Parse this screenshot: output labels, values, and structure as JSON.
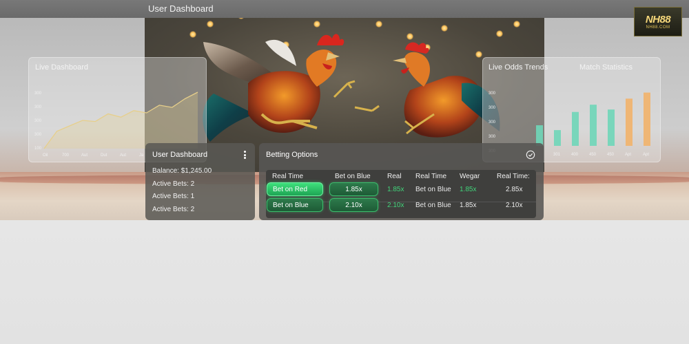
{
  "app": {
    "title": "User Dashboard",
    "logo_line1": "NH88",
    "logo_line2": "NH88.COM"
  },
  "left_panel": {
    "title": "Live Dashboard",
    "y_ticks": [
      "300",
      "300",
      "300",
      "300",
      "100"
    ],
    "x_ticks": [
      "Oil",
      "700",
      "Aut",
      "Dut",
      "Aut",
      "Ja"
    ]
  },
  "right_panel": {
    "title_1": "Live Odds Trends",
    "title_2": "Match Statistics",
    "y_ticks": [
      "300",
      "300",
      "300",
      "300",
      "300"
    ],
    "x_ticks": [
      "301",
      "400",
      "450",
      "450",
      "Apt",
      "Apt"
    ]
  },
  "user_card": {
    "title": "User Dashboard",
    "balance": "Balance: $1,245.00",
    "active_1": "Active Bets: 2",
    "active_2": "Active Bets: 1",
    "active_3": "Active Bets: 2"
  },
  "betting": {
    "title": "Betting Options",
    "headers": [
      "Real Time",
      "Bet on Blue",
      "Real",
      "Real Time",
      "Wegar",
      "Real Time:"
    ],
    "rows": [
      {
        "bet": "Bet on Red",
        "odds": "1.85x",
        "real": "1.85x",
        "label": "Bet on Blue",
        "wager": "1.85x",
        "rt": "2.85x"
      },
      {
        "bet": "Bet on Blue",
        "odds": "2.10x",
        "real": "2.10x",
        "label": "Bet on Blue",
        "wager": "1.85x",
        "rt": "2.10x"
      }
    ]
  },
  "colors": {
    "accent_green": "#41d47a",
    "bar_teal": "#6fd6b8",
    "bar_orange": "#f2b36a",
    "line_gold": "#e7cf8a"
  },
  "chart_data": [
    {
      "type": "area",
      "title": "Live Dashboard",
      "x": [
        "Oil",
        "700",
        "Aut",
        "Dut",
        "Aut",
        "Ja"
      ],
      "series": [
        {
          "values": [
            100,
            180,
            205,
            230,
            225,
            260,
            245,
            275,
            265,
            300,
            290,
            330,
            360
          ]
        }
      ],
      "ylim": [
        100,
        360
      ]
    },
    {
      "type": "bar",
      "title": "Match Statistics",
      "categories": [
        "",
        "301",
        "400",
        "450",
        "450",
        "Apt",
        "Apt"
      ],
      "values": [
        135,
        115,
        190,
        220,
        200,
        245,
        270
      ],
      "ylim": [
        50,
        300
      ]
    }
  ]
}
